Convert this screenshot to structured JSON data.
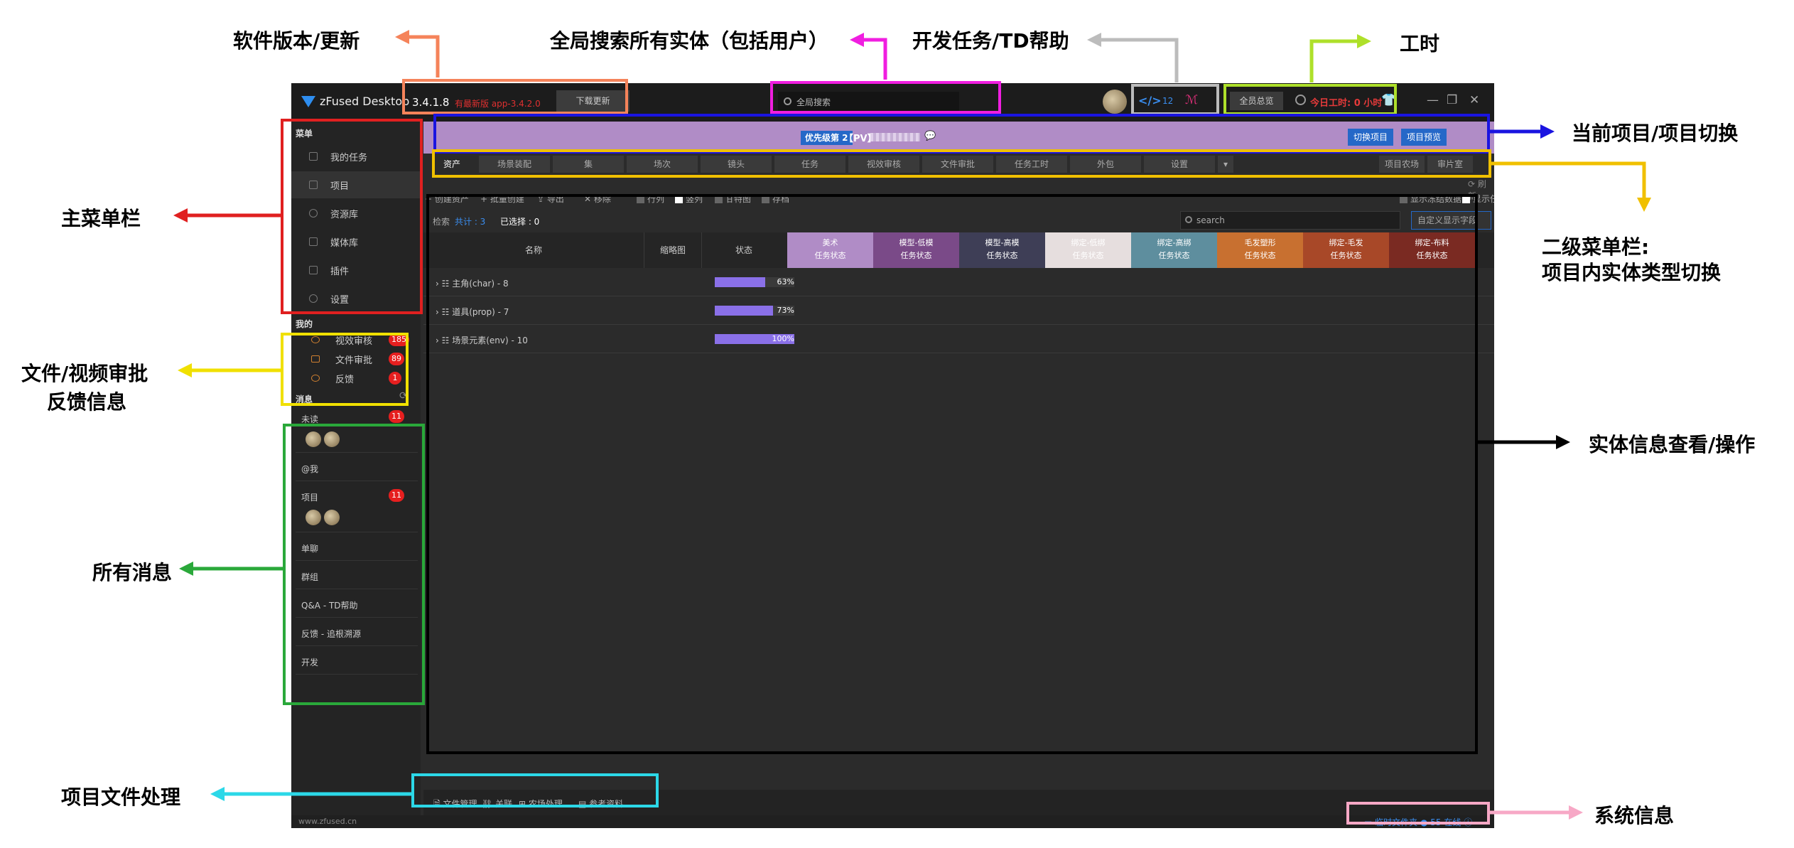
{
  "titlebar": {
    "app_name": "zFused Desktop",
    "version": "3.4.1.8",
    "new_version": "有最新版 app-3.4.2.0",
    "download_label": "下载更新",
    "search_placeholder": "全局搜索",
    "dev_count": "12",
    "overview_label": "全员总览",
    "work_time": "今日工时: 0 小时"
  },
  "sidebar": {
    "menu_title": "菜单",
    "menu_items": [
      "我的任务",
      "项目",
      "资源库",
      "媒体库",
      "插件",
      "设置"
    ],
    "mine_title": "我的",
    "mine_items": [
      {
        "label": "视效审核",
        "count": "185"
      },
      {
        "label": "文件审批",
        "count": "89"
      },
      {
        "label": "反馈",
        "count": "1"
      }
    ],
    "messages_title": "消息",
    "messages": [
      {
        "label": "未读",
        "count": "11"
      },
      {
        "label": "@我",
        "count": ""
      },
      {
        "label": "项目",
        "count": "11"
      },
      {
        "label": "单聊",
        "count": ""
      },
      {
        "label": "群组",
        "count": ""
      },
      {
        "label": "Q&A - TD帮助",
        "count": ""
      },
      {
        "label": "反馈 - 追根溯源",
        "count": ""
      },
      {
        "label": "开发",
        "count": ""
      }
    ]
  },
  "project": {
    "priority": "优先级第 2",
    "name": "【PV】",
    "switch_label": "切换项目",
    "preview_label": "项目预览"
  },
  "tabs": [
    "资产",
    "场景装配",
    "集",
    "场次",
    "镜头",
    "任务",
    "视效审核",
    "文件审批",
    "任务工时",
    "外包",
    "设置"
  ],
  "tabs_right": [
    "项目农场",
    "审片室"
  ],
  "refresh_label": "刷新",
  "toolbar": {
    "create": "创建资产",
    "batch": "批量创建",
    "export": "导出",
    "remove": "移除",
    "row_label": "行列",
    "vertical_label": "竖列",
    "gantt_label": "甘特图",
    "archive_label": "存档",
    "show_frozen": "显示冻结数据",
    "show_tasks": "显示任务"
  },
  "filter": {
    "search_label": "检索",
    "total": "共计 : 3",
    "selected": "已选择 : 0",
    "search_placeholder": "search",
    "custom_label": "自定义显示字段"
  },
  "grid": {
    "col_name": "名称",
    "col_thumb": "缩略图",
    "col_status": "状态",
    "status_sub": "任务状态",
    "status_columns": [
      {
        "name": "美术",
        "color": "#b08cc6"
      },
      {
        "name": "模型-低模",
        "color": "#7a4a88"
      },
      {
        "name": "模型-高模",
        "color": "#3e3e56"
      },
      {
        "name": "绑定-低绑",
        "color": "#e6dede"
      },
      {
        "name": "绑定-高绑",
        "color": "#5e8e9e"
      },
      {
        "name": "毛发塑形",
        "color": "#c87030"
      },
      {
        "name": "绑定-毛发",
        "color": "#a84828"
      },
      {
        "name": "绑定-布料",
        "color": "#7a2a22"
      }
    ],
    "rows": [
      {
        "name": "主角(char) - 8",
        "progress": 0.63,
        "label": "63%"
      },
      {
        "name": "道具(prop) - 7",
        "progress": 0.73,
        "label": "73%"
      },
      {
        "name": "场景元素(env) - 10",
        "progress": 1.0,
        "label": "100%"
      }
    ]
  },
  "bottom": [
    "文件管理",
    "关联",
    "农场处理",
    "参考资料"
  ],
  "footer": {
    "url": "www.zfused.cn",
    "temp_folder": "临时文件夹",
    "online": "55 在线"
  },
  "annotations": {
    "version": "软件版本/更新",
    "search": "全局搜索所有实体（包括用户）",
    "dev": "开发任务/TD帮助",
    "worktime": "工时",
    "project_switch": "当前项目/项目切换",
    "menu": "主菜单栏",
    "sub_menu_1": "二级菜单栏:",
    "sub_menu_2": "项目内实体类型切换",
    "review_1": "文件/视频审批",
    "review_2": "反馈信息",
    "entity": "实体信息查看/操作",
    "messages": "所有消息",
    "files": "项目文件处理",
    "system": "系统信息"
  }
}
